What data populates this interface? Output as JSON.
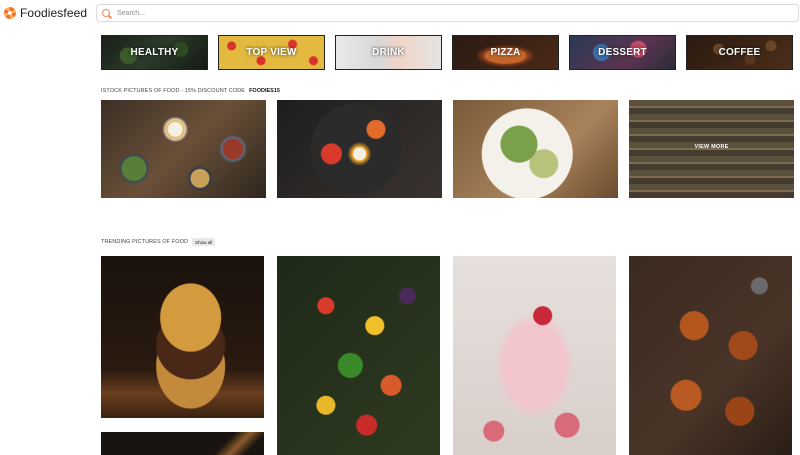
{
  "brand": {
    "name": "Foodiesfeed"
  },
  "search": {
    "placeholder": "Search..."
  },
  "categories": [
    {
      "label": "HEALTHY"
    },
    {
      "label": "TOP VIEW"
    },
    {
      "label": "DRINK"
    },
    {
      "label": "PIZZA"
    },
    {
      "label": "DESSERT"
    },
    {
      "label": "COFFEE"
    }
  ],
  "istock": {
    "title": "ISTOCK PICTURES OF FOOD - 15% DISCOUNT CODE",
    "code": "FOODIES15",
    "view_more": "VIEW MORE"
  },
  "trending": {
    "title": "TRENDING PICTURES OF FOOD",
    "show_all": "Show all"
  },
  "colors": {
    "accent": "#f08a5d",
    "text": "#222222",
    "background": "#ffffff"
  }
}
